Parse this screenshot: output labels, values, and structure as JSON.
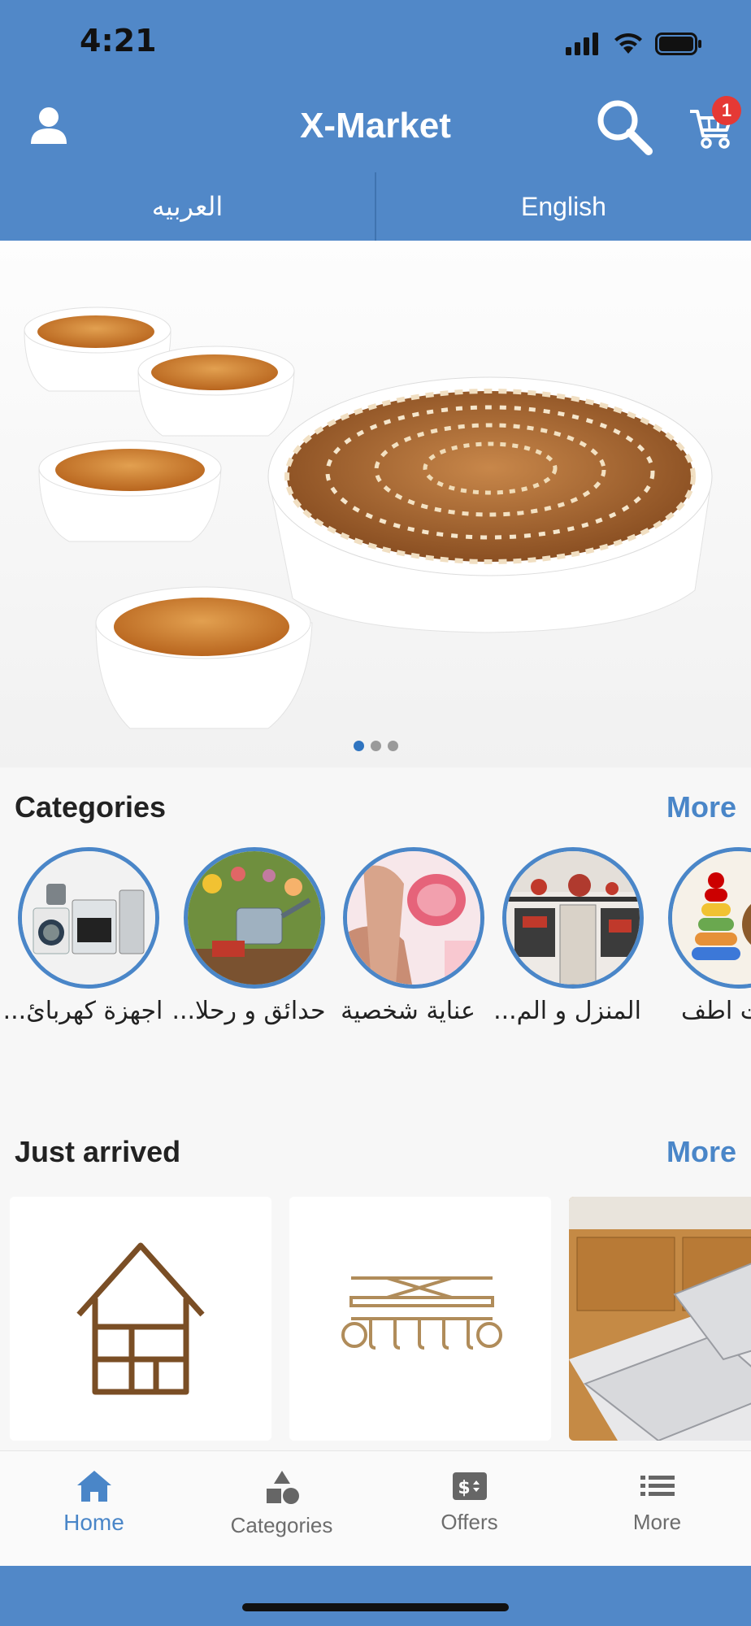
{
  "status_bar": {
    "time": "4:21"
  },
  "header": {
    "title": "X-Market",
    "cart_count": "1",
    "icons": [
      "user-icon",
      "search-icon",
      "cart-icon"
    ]
  },
  "language": {
    "arabic_label": "العربيه",
    "english_label": "English"
  },
  "banner": {
    "slide_count": 3,
    "active_slide": 1
  },
  "categories": {
    "title": "Categories",
    "more_label": "More",
    "items": [
      {
        "label": "اجهزة كهربائ..."
      },
      {
        "label": "حدائق و رحلا..."
      },
      {
        "label": "عناية شخصية"
      },
      {
        "label": "المنزل و الم..."
      },
      {
        "label": "عات اطف"
      }
    ]
  },
  "just_arrived": {
    "title": "Just arrived",
    "more_label": "More"
  },
  "tabs": [
    {
      "label": "Home",
      "icon": "home-icon",
      "active": true
    },
    {
      "label": "Categories",
      "icon": "shapes-icon",
      "active": false
    },
    {
      "label": "Offers",
      "icon": "price-tag-icon",
      "active": false
    },
    {
      "label": "More",
      "icon": "list-icon",
      "active": false
    }
  ],
  "colors": {
    "brand": "#5188c8",
    "accent": "#4a86c8",
    "badge": "#e53935"
  }
}
